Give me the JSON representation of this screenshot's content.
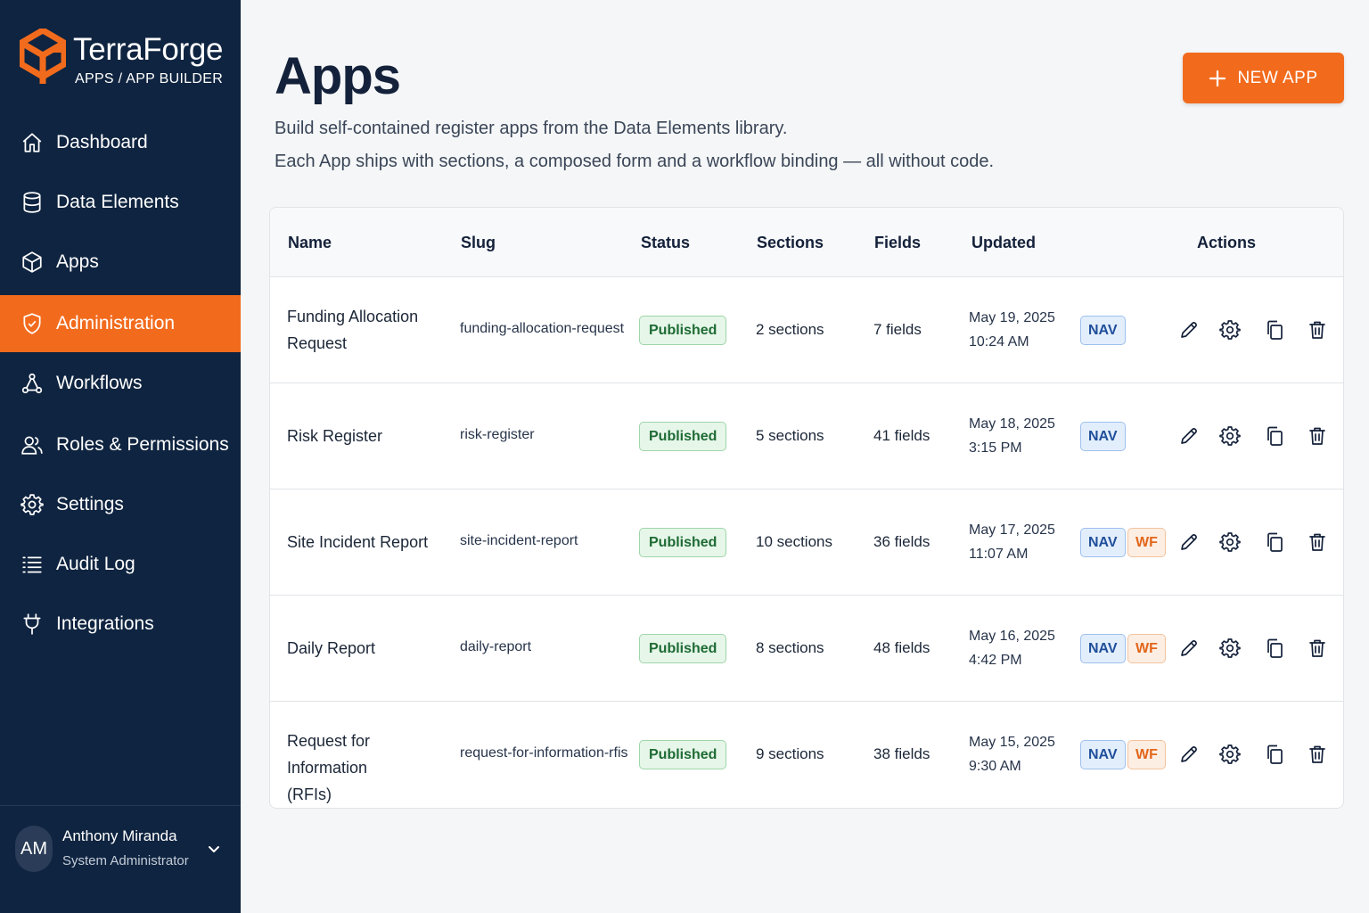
{
  "brand": {
    "name": "TerraForge",
    "subtitle": "APPS / APP BUILDER"
  },
  "colors": {
    "sidebar": "#0f2440",
    "accent": "#f26b1d",
    "published_bg": "#e6f6e9",
    "nav_tag": "#1f4f9a",
    "wf_tag": "#e2661b"
  },
  "sidebar": {
    "items": [
      {
        "label": "Dashboard",
        "icon": "home-icon"
      },
      {
        "label": "Data Elements",
        "icon": "database-icon"
      },
      {
        "label": "Apps",
        "icon": "cube-icon"
      },
      {
        "label": "Administration",
        "icon": "shield-check-icon",
        "active": true
      },
      {
        "label": "Workflows",
        "icon": "workflow-icon"
      },
      {
        "label": "Roles & Permissions",
        "icon": "users-icon"
      },
      {
        "label": "Settings",
        "icon": "gear-icon"
      },
      {
        "label": "Audit Log",
        "icon": "list-icon"
      },
      {
        "label": "Integrations",
        "icon": "plug-icon"
      }
    ]
  },
  "user": {
    "initials": "AM",
    "name": "Anthony Miranda",
    "role": "System Administrator"
  },
  "header": {
    "title": "Apps",
    "subtitle_1": "Build self-contained register apps from the Data Elements library.",
    "subtitle_2": "Each App ships with sections, a composed form and a workflow binding — all without code.",
    "new_button": "NEW APP"
  },
  "table": {
    "columns": {
      "name": "Name",
      "slug": "Slug",
      "status": "Status",
      "sections": "Sections",
      "fields": "Fields",
      "updated": "Updated",
      "actions": "Actions"
    },
    "rows": [
      {
        "name_1": "Funding Allocation",
        "name_2": "Request",
        "slug": "funding-allocation-request",
        "status": "Published",
        "sections": "2 sections",
        "fields": "7 fields",
        "date": "May 19, 2025",
        "time": "10:24 AM",
        "nav": "NAV",
        "wf": ""
      },
      {
        "name_1": "Risk Register",
        "name_2": "",
        "slug": "risk-register",
        "status": "Published",
        "sections": "5 sections",
        "fields": "41 fields",
        "date": "May 18, 2025",
        "time": "3:15 PM",
        "nav": "NAV",
        "wf": ""
      },
      {
        "name_1": "Site Incident Report",
        "name_2": "",
        "slug": "site-incident-report",
        "status": "Published",
        "sections": "10 sections",
        "fields": "36 fields",
        "date": "May 17, 2025",
        "time": "11:07 AM",
        "nav": "NAV",
        "wf": "WF"
      },
      {
        "name_1": "Daily Report",
        "name_2": "",
        "slug": "daily-report",
        "status": "Published",
        "sections": "8 sections",
        "fields": "48 fields",
        "date": "May 16, 2025",
        "time": "4:42 PM",
        "nav": "NAV",
        "wf": "WF"
      },
      {
        "name_1": "Request for Information",
        "name_2": "(RFIs)",
        "slug": "request-for-information-rfis",
        "status": "Published",
        "sections": "9 sections",
        "fields": "38 fields",
        "date": "May 15, 2025",
        "time": "9:30 AM",
        "nav": "NAV",
        "wf": "WF"
      }
    ]
  }
}
